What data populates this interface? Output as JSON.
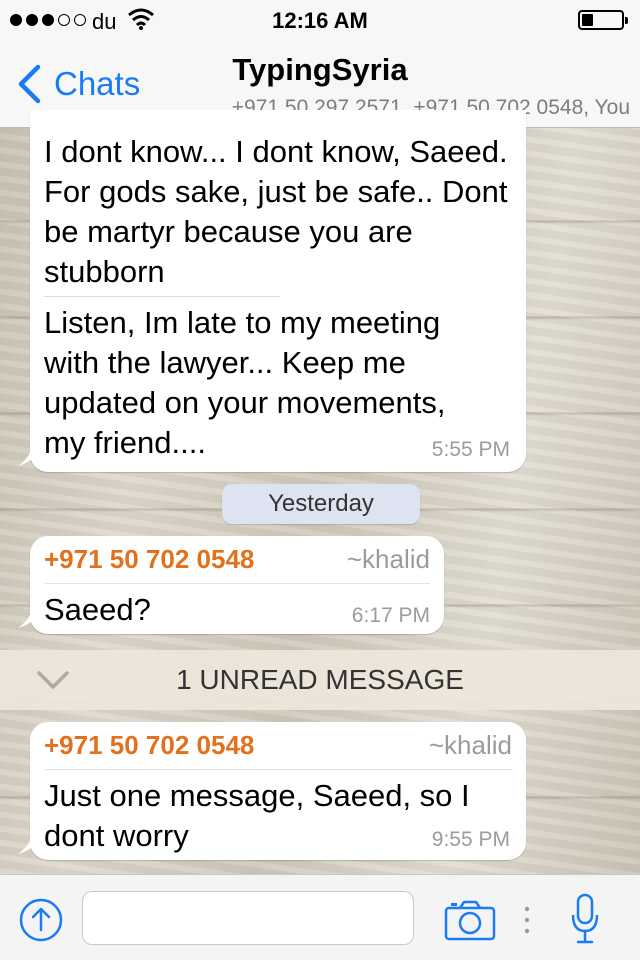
{
  "status_bar": {
    "carrier": "du",
    "time": "12:16 AM",
    "battery_level": 0.3
  },
  "nav": {
    "back_label": "Chats",
    "title": "TypingSyria",
    "subtitle": "+971 50 297 2571, +971 50 702 0548, You"
  },
  "messages": [
    {
      "text_part1": "I dont know... I dont know, Saeed. For gods sake, just be safe.. Dont be martyr because you are stubborn",
      "text_part2": "Listen, Im late to my meeting with the lawyer... Keep me updated on your movements, my friend....",
      "time": "5:55 PM"
    },
    {
      "sender_phone": "+971 50 702 0548",
      "sender_name": "~khalid",
      "text": "Saeed?",
      "time": "6:17 PM"
    },
    {
      "sender_phone": "+971 50 702 0548",
      "sender_name": "~khalid",
      "text": "Just one message, Saeed, so I dont worry",
      "time": "9:55 PM"
    }
  ],
  "date_divider": "Yesterday",
  "unread_banner": "1 UNREAD MESSAGE",
  "input": {
    "placeholder": ""
  },
  "icons": {
    "share": "share-up-arrow-icon",
    "camera": "camera-icon",
    "mic": "microphone-icon",
    "back": "chevron-left-icon"
  },
  "colors": {
    "accent": "#1a7cf5",
    "sender": "#e2711d"
  }
}
